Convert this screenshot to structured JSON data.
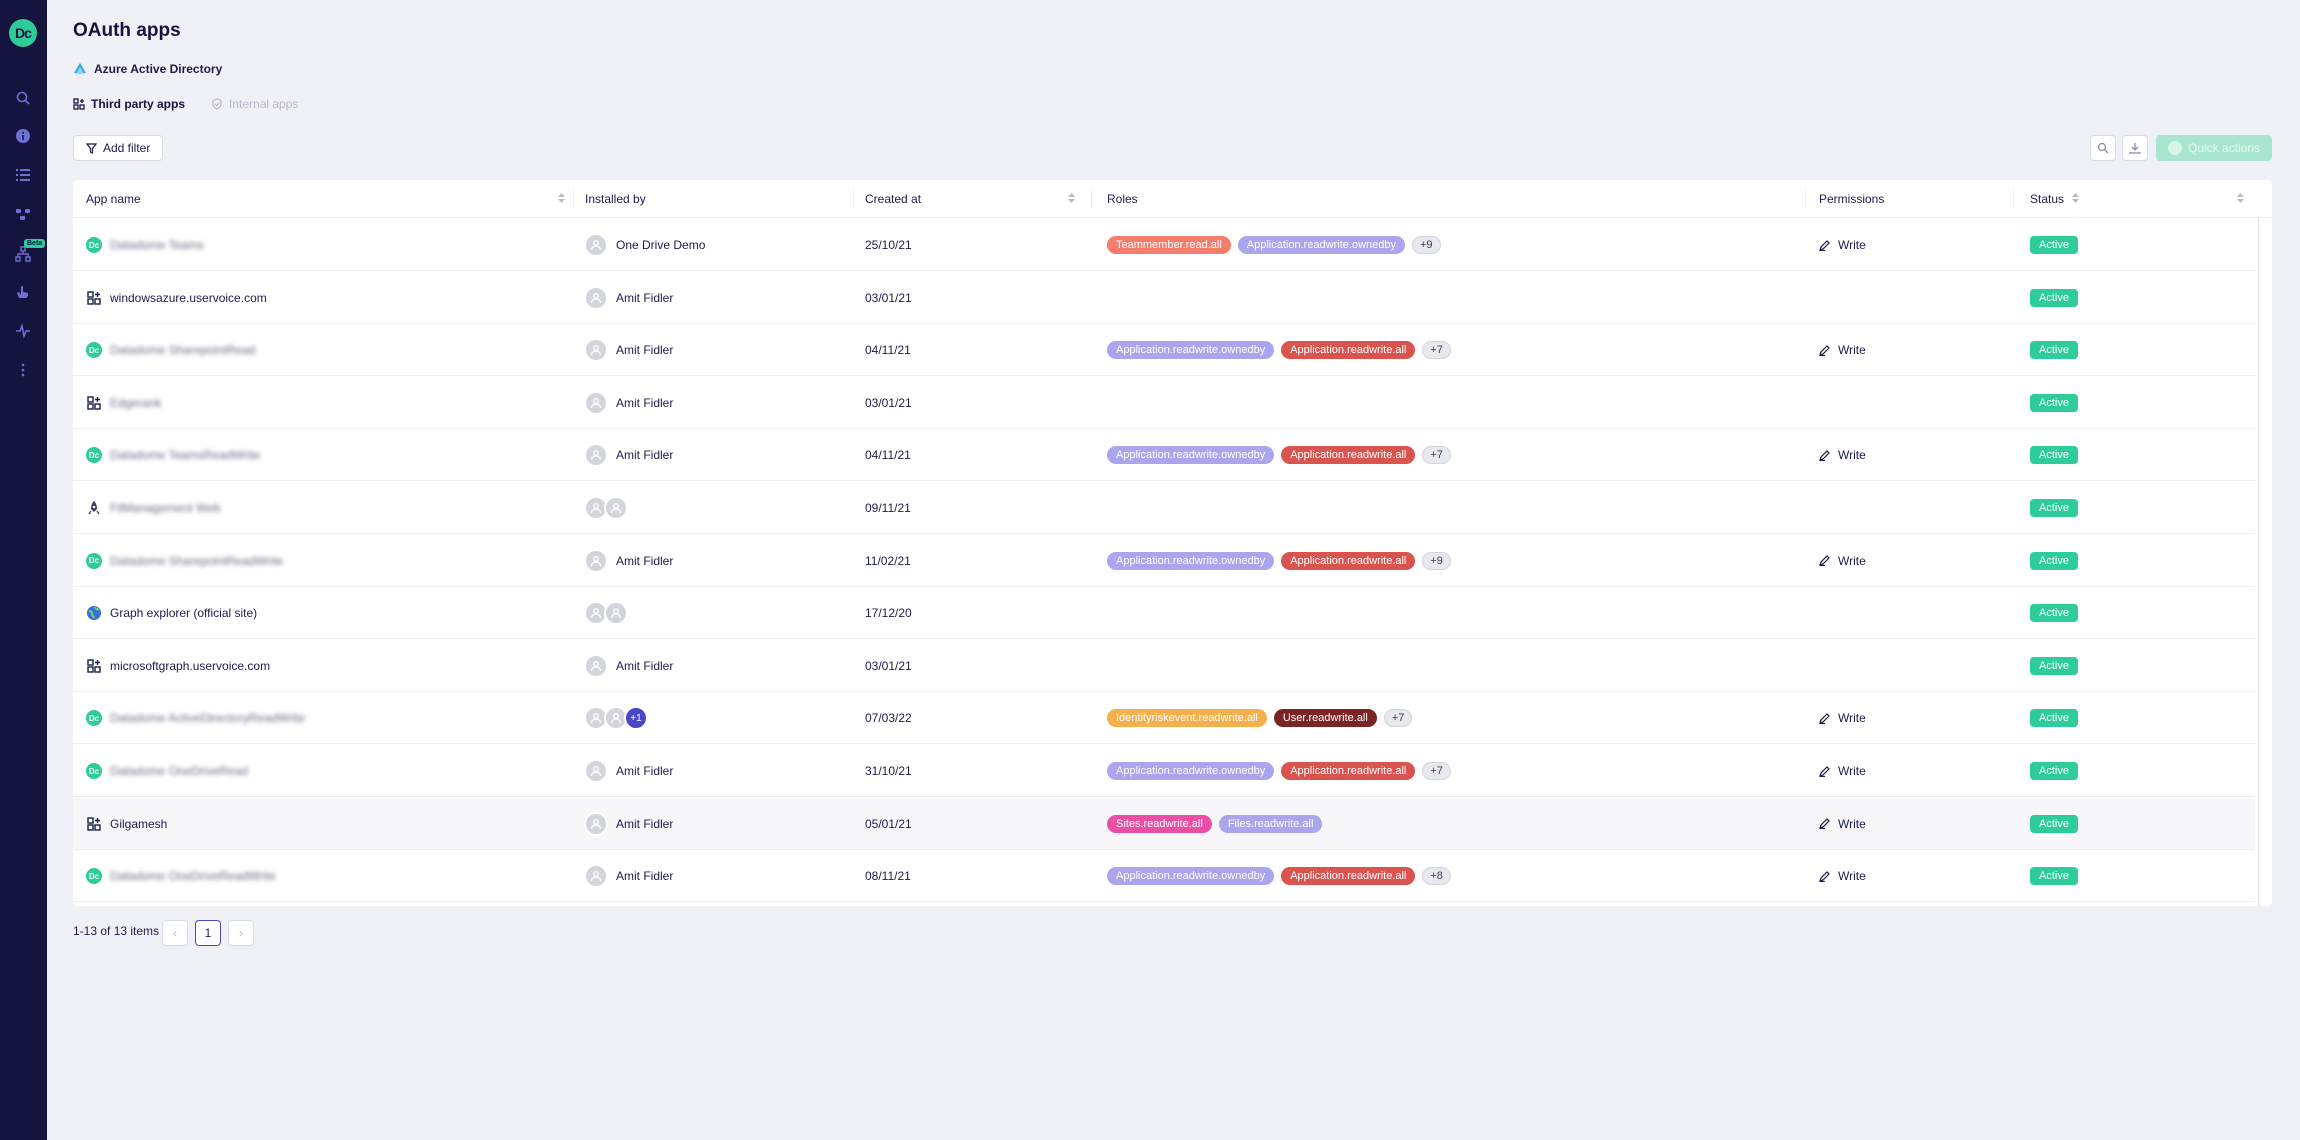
{
  "sidebar": {
    "logo": "Dc",
    "beta_label": "Beta",
    "icons": [
      "search-icon",
      "info-icon",
      "list-icon",
      "flow-icon",
      "hierarchy-icon",
      "hand-icon",
      "activity-icon",
      "more-vertical-icon"
    ]
  },
  "header": {
    "title": "OAuth apps",
    "provider": "Azure Active Directory",
    "tabs": [
      {
        "label": "Third party apps",
        "active": true
      },
      {
        "label": "Internal apps",
        "active": false
      }
    ]
  },
  "toolbar": {
    "add_filter": "Add filter",
    "quick_actions": "Quick actions"
  },
  "table": {
    "columns": [
      "App name",
      "Installed by",
      "Created at",
      "Roles",
      "Permissions",
      "Status"
    ],
    "rows": [
      {
        "app": "Datadome Teams",
        "icon": "dc",
        "blurred": true,
        "installers": [
          "One Drive Demo"
        ],
        "created": "25/10/21",
        "roles": [
          {
            "t": "Teammember.read.all",
            "c": "#f47d6b"
          },
          {
            "t": "Application.readwrite.ownedby",
            "c": "#aaa5ec"
          }
        ],
        "more": "+9",
        "perm": "Write",
        "status": "Active"
      },
      {
        "app": "windowsazure.uservoice.com",
        "icon": "app",
        "blurred": false,
        "installers": [
          "Amit Fidler"
        ],
        "created": "03/01/21",
        "roles": [],
        "more": "",
        "perm": "",
        "status": "Active"
      },
      {
        "app": "Datadome SharepointRead",
        "icon": "dc",
        "blurred": true,
        "installers": [
          "Amit Fidler"
        ],
        "created": "04/11/21",
        "roles": [
          {
            "t": "Application.readwrite.ownedby",
            "c": "#aaa5ec"
          },
          {
            "t": "Application.readwrite.all",
            "c": "#d9534f"
          }
        ],
        "more": "+7",
        "perm": "Write",
        "status": "Active"
      },
      {
        "app": "Edgerank",
        "icon": "app",
        "blurred": true,
        "installers": [
          "Amit Fidler"
        ],
        "created": "03/01/21",
        "roles": [],
        "more": "",
        "perm": "",
        "status": "Active"
      },
      {
        "app": "Datadome TeamsReadWrite",
        "icon": "dc",
        "blurred": true,
        "installers": [
          "Amit Fidler"
        ],
        "created": "04/11/21",
        "roles": [
          {
            "t": "Application.readwrite.ownedby",
            "c": "#aaa5ec"
          },
          {
            "t": "Application.readwrite.all",
            "c": "#d9534f"
          }
        ],
        "more": "+7",
        "perm": "Write",
        "status": "Active"
      },
      {
        "app": "FilManagement Web",
        "icon": "rocket",
        "blurred": true,
        "installers": [
          "",
          ""
        ],
        "created": "09/11/21",
        "roles": [],
        "more": "",
        "perm": "",
        "status": "Active"
      },
      {
        "app": "Datadome SharepointReadWrite",
        "icon": "dc",
        "blurred": true,
        "installers": [
          "Amit Fidler"
        ],
        "created": "11/02/21",
        "roles": [
          {
            "t": "Application.readwrite.ownedby",
            "c": "#aaa5ec"
          },
          {
            "t": "Application.readwrite.all",
            "c": "#d9534f"
          }
        ],
        "more": "+9",
        "perm": "Write",
        "status": "Active"
      },
      {
        "app": "Graph explorer (official site)",
        "icon": "globe",
        "blurred": false,
        "installers": [
          "",
          ""
        ],
        "created": "17/12/20",
        "roles": [],
        "more": "",
        "perm": "",
        "status": "Active"
      },
      {
        "app": "microsoftgraph.uservoice.com",
        "icon": "app",
        "blurred": false,
        "installers": [
          "Amit Fidler"
        ],
        "created": "03/01/21",
        "roles": [],
        "more": "",
        "perm": "",
        "status": "Active"
      },
      {
        "app": "Datadome ActiveDirectoryReadWrite",
        "icon": "dc",
        "blurred": true,
        "installers": [
          "",
          "",
          "+1"
        ],
        "created": "07/03/22",
        "roles": [
          {
            "t": "Identityriskevent.readwrite.all",
            "c": "#f5b04e"
          },
          {
            "t": "User.readwrite.all",
            "c": "#7a2424"
          }
        ],
        "more": "+7",
        "perm": "Write",
        "status": "Active"
      },
      {
        "app": "Datadome OneDriveRead",
        "icon": "dc",
        "blurred": true,
        "installers": [
          "Amit Fidler"
        ],
        "created": "31/10/21",
        "roles": [
          {
            "t": "Application.readwrite.ownedby",
            "c": "#aaa5ec"
          },
          {
            "t": "Application.readwrite.all",
            "c": "#d9534f"
          }
        ],
        "more": "+7",
        "perm": "Write",
        "status": "Active"
      },
      {
        "app": "Gilgamesh",
        "icon": "app",
        "blurred": false,
        "highlight": true,
        "installers": [
          "Amit Fidler"
        ],
        "created": "05/01/21",
        "roles": [
          {
            "t": "Sites.readwrite.all",
            "c": "#e84fa5"
          },
          {
            "t": "Files.readwrite.all",
            "c": "#aaa5ec"
          }
        ],
        "more": "",
        "perm": "Write",
        "status": "Active"
      },
      {
        "app": "Datadome OneDriveReadWrite",
        "icon": "dc",
        "blurred": true,
        "installers": [
          "Amit Fidler"
        ],
        "created": "08/11/21",
        "roles": [
          {
            "t": "Application.readwrite.ownedby",
            "c": "#aaa5ec"
          },
          {
            "t": "Application.readwrite.all",
            "c": "#d9534f"
          }
        ],
        "more": "+8",
        "perm": "Write",
        "status": "Active"
      }
    ]
  },
  "pagination": {
    "summary": "1-13 of 13 items",
    "prev": "‹",
    "current": "1",
    "next": "›"
  }
}
